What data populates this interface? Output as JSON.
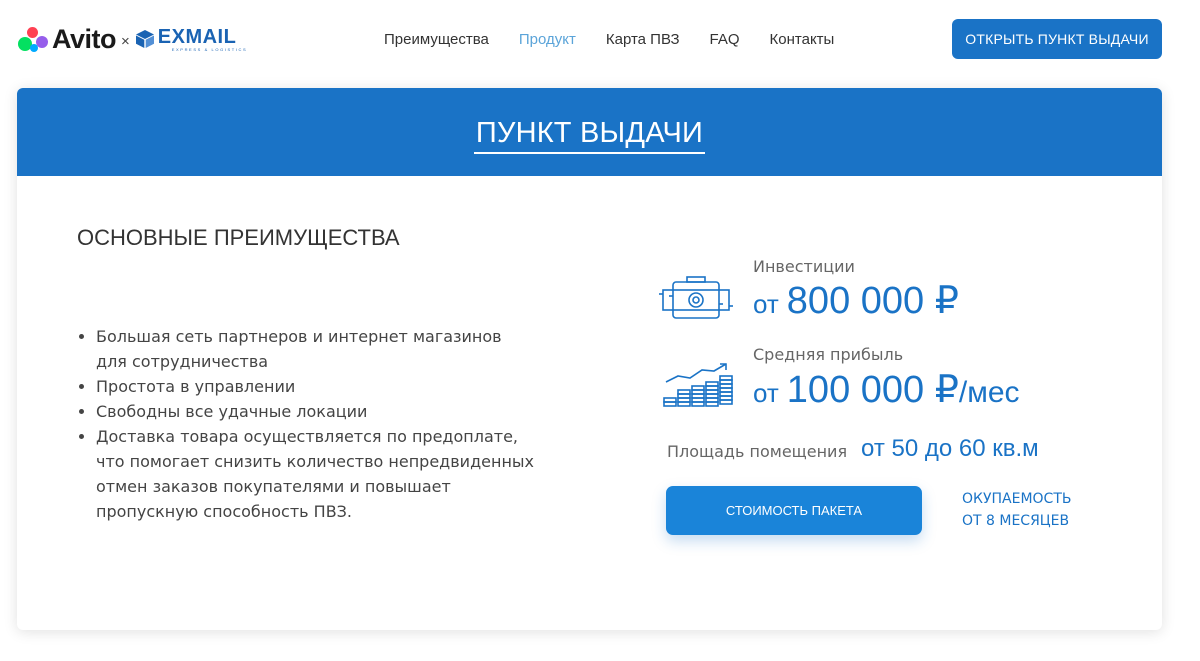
{
  "header": {
    "logo_avito": "Avito",
    "logo_cross": "×",
    "logo_exmail": "EXMAIL",
    "logo_exmail_sub": "EXPRESS & LOGISTICS",
    "nav": [
      {
        "label": "Преимущества",
        "active": false
      },
      {
        "label": "Продукт",
        "active": true
      },
      {
        "label": "Карта ПВЗ",
        "active": false
      },
      {
        "label": "FAQ",
        "active": false
      },
      {
        "label": "Контакты",
        "active": false
      }
    ],
    "cta_label": "ОТКРЫТЬ ПУНКТ ВЫДАЧИ"
  },
  "card": {
    "title": "ПУНКТ ВЫДАЧИ",
    "advantages_title": "ОСНОВНЫЕ ПРЕИМУЩЕСТВА",
    "advantages": [
      "Большая сеть партнеров и интернет магазинов для сотрудничества",
      "Простота в управлении",
      "Свободны все удачные локации",
      "Доставка товара осуществляется по предоплате, что помогает снизить количество непредвиденных отмен заказов покупателями и повышает пропускную способность ПВЗ."
    ],
    "investment": {
      "label": "Инвестиции",
      "prefix": "от",
      "value": "800 000 ₽",
      "suffix": "",
      "icon": "money-briefcase-icon"
    },
    "profit": {
      "label": "Средняя прибыль",
      "prefix": "от",
      "value": "100 000 ₽",
      "suffix": "/мес",
      "icon": "growth-chart-icon"
    },
    "area": {
      "label": "Площадь помещения",
      "value": "от 50 до 60 кв.м"
    },
    "cost_button": "СТОИМОСТЬ ПАКЕТА",
    "payback_line1": "ОКУПАЕМОСТЬ",
    "payback_line2": "ОТ 8 МЕСЯЦЕВ"
  },
  "colors": {
    "primary": "#1a73c6",
    "nav_active": "#5ba4d9",
    "text": "#444444"
  }
}
